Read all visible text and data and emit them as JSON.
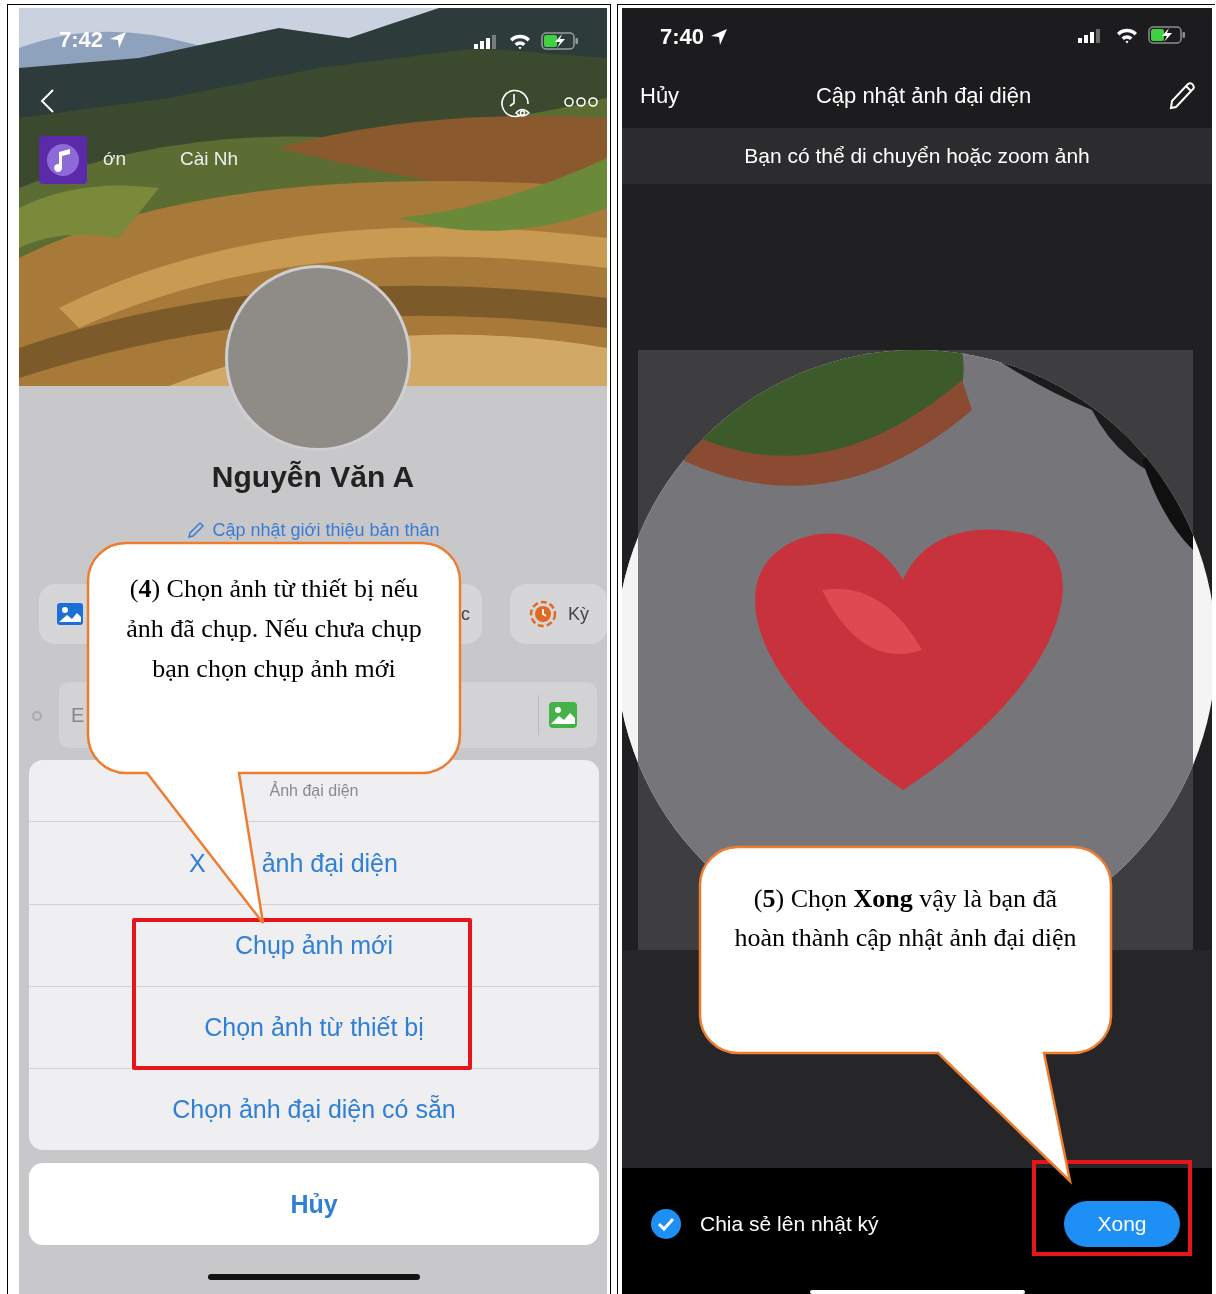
{
  "left_screen": {
    "status_bar": {
      "time": "7:42"
    },
    "shortcuts": [
      {
        "label": "ớn"
      },
      {
        "label": "Cài Nh"
      }
    ],
    "profile": {
      "name": "Nguyễn Văn A",
      "bio_link": "Cập nhật giới thiệu bản thân"
    },
    "chips": [
      {
        "label": "c"
      },
      {
        "label": "Kỳ"
      }
    ],
    "composer": {
      "placeholder": "E"
    },
    "action_sheet": {
      "title": "Ảnh đại diện",
      "items": [
        {
          "parts": [
            "X",
            "ảnh đại diện"
          ]
        },
        {
          "label": "Chụp ảnh mới"
        },
        {
          "label": "Chọn ảnh từ thiết bị"
        },
        {
          "label": "Chọn ảnh đại diện có sẵn"
        }
      ],
      "cancel": "Hủy"
    },
    "callout": {
      "text": "(**4**) Chọn ảnh từ thiết bị nếu ảnh đã chụp. Nếu chưa chụp bạn chọn chụp ảnh mới"
    }
  },
  "right_screen": {
    "status_bar": {
      "time": "7:40"
    },
    "nav": {
      "cancel": "Hủy",
      "title": "Cập nhật ảnh đại diện"
    },
    "hint": "Bạn có thể di chuyển hoặc zoom ảnh",
    "share_option": {
      "label": "Chia sẻ lên nhật ký",
      "checked": true
    },
    "done_button": "Xong",
    "callout": {
      "text": "(**5**) Chọn **Xong** vậy là bạn đã hoàn thành cập nhật ảnh đại diện"
    }
  }
}
